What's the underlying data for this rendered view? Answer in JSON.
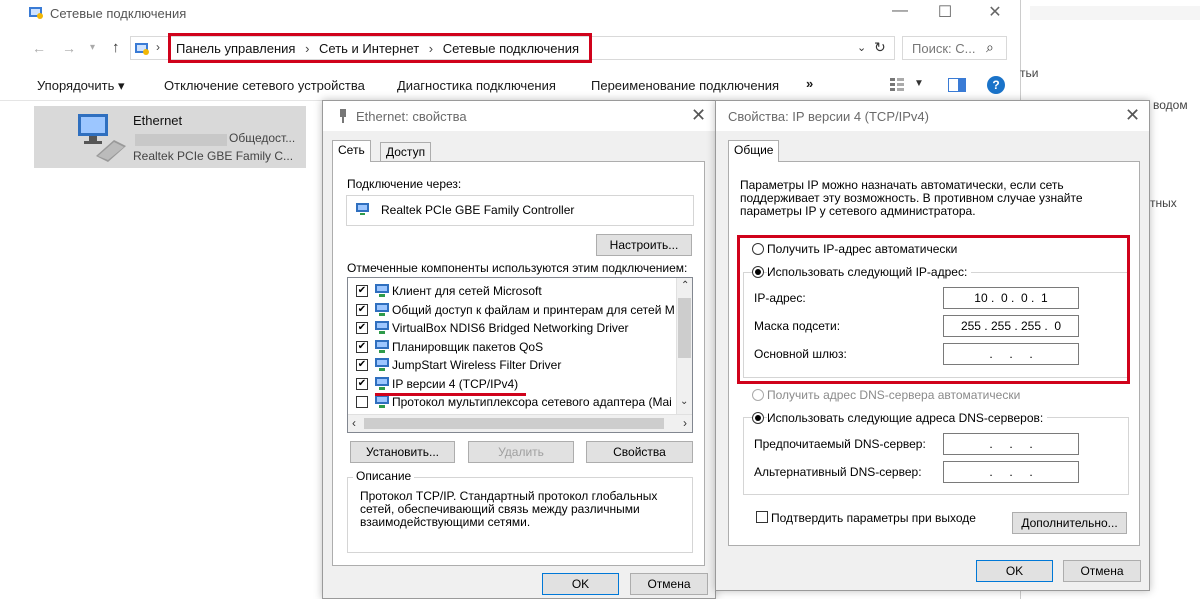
{
  "window": {
    "title": "Сетевые подключения",
    "min_glyph": "—",
    "max_glyph": "☐",
    "close_glyph": "✕"
  },
  "address": {
    "crumbs": [
      "Панель управления",
      "Сеть и Интернет",
      "Сетевые подключения"
    ],
    "search_placeholder": "Поиск: С..."
  },
  "toolbar": {
    "organize": "Упорядочить ▾",
    "disable": "Отключение сетевого устройства",
    "diagnose": "Диагностика подключения",
    "rename": "Переименование подключения",
    "more": "»"
  },
  "connection": {
    "name": "Ethernet",
    "status": "Общедост...",
    "adapter": "Realtek PCIe GBE Family C..."
  },
  "background_fragments": [
    "тьи",
    "водом",
    "тных"
  ],
  "eth_dialog": {
    "title": "Ethernet: свойства",
    "tabs": [
      "Сеть",
      "Доступ"
    ],
    "connect_using_label": "Подключение через:",
    "adapter_name": "Realtek PCIe GBE Family Controller",
    "configure_btn": "Настроить...",
    "components_label": "Отмеченные компоненты используются этим подключением:",
    "components": [
      {
        "label": "Клиент для сетей Microsoft",
        "checked": true
      },
      {
        "label": "Общий доступ к файлам и принтерам для сетей Mi",
        "checked": true
      },
      {
        "label": "VirtualBox NDIS6 Bridged Networking Driver",
        "checked": true
      },
      {
        "label": "Планировщик пакетов QoS",
        "checked": true
      },
      {
        "label": "JumpStart Wireless Filter Driver",
        "checked": true
      },
      {
        "label": "IP версии 4 (TCP/IPv4)",
        "checked": true
      },
      {
        "label": "Протокол мультиплексора сетевого адаптера (Mai",
        "checked": false
      }
    ],
    "install_btn": "Установить...",
    "remove_btn": "Удалить",
    "properties_btn": "Свойства",
    "description_title": "Описание",
    "description_text": "Протокол TCP/IP. Стандартный протокол глобальных сетей, обеспечивающий связь между различными взаимодействующими сетями.",
    "ok_btn": "OK",
    "cancel_btn": "Отмена"
  },
  "ipv4_dialog": {
    "title": "Свойства: IP версии 4 (TCP/IPv4)",
    "tab": "Общие",
    "intro": "Параметры IP можно назначать автоматически, если сеть поддерживает эту возможность. В противном случае узнайте параметры IP у сетевого администратора.",
    "auto_ip_label": "Получить IP-адрес автоматически",
    "manual_ip_label": "Использовать следующий IP-адрес:",
    "ip_label": "IP-адрес:",
    "ip_value": "10 .  0 .  0 .  1",
    "mask_label": "Маска подсети:",
    "mask_value": "255 . 255 . 255 .  0",
    "gateway_label": "Основной шлюз:",
    "gateway_value": ".     .     .",
    "auto_dns_label": "Получить адрес DNS-сервера автоматически",
    "manual_dns_label": "Использовать следующие адреса DNS-серверов:",
    "pref_dns_label": "Предпочитаемый DNS-сервер:",
    "pref_dns_value": ".     .     .",
    "alt_dns_label": "Альтернативный DNS-сервер:",
    "alt_dns_value": ".     .     .",
    "validate_label": "Подтвердить параметры при выходе",
    "advanced_btn": "Дополнительно...",
    "ok_btn": "OK",
    "cancel_btn": "Отмена"
  },
  "colors": {
    "highlight_red": "#d0021b",
    "help_blue": "#1a73c9"
  }
}
